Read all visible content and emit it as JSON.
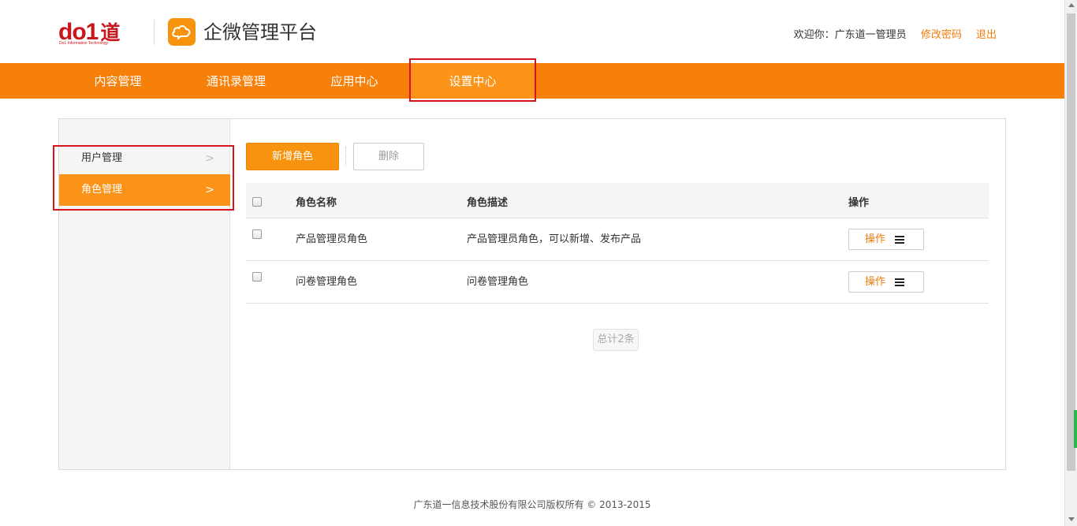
{
  "header": {
    "logo_text": "do1",
    "logo_dao": "道",
    "logo_subtitle": "Do1 Information Technology",
    "brand_icon": "cloud-chat-icon",
    "brand_title": "企微管理平台",
    "welcome": "欢迎你：广东道一管理员",
    "change_password": "修改密码",
    "logout": "退出"
  },
  "nav": {
    "items": [
      {
        "label": "内容管理"
      },
      {
        "label": "通讯录管理"
      },
      {
        "label": "应用中心"
      },
      {
        "label": "设置中心"
      }
    ],
    "active_index": 3
  },
  "sidebar": {
    "items": [
      {
        "label": "用户管理",
        "chevron": ">"
      },
      {
        "label": "角色管理",
        "chevron": ">"
      }
    ],
    "active_index": 1
  },
  "toolbar": {
    "add_label": "新增角色",
    "delete_label": "删除"
  },
  "table": {
    "columns": [
      "角色名称",
      "角色描述",
      "操作"
    ],
    "rows": [
      {
        "name": "产品管理员角色",
        "description": "产品管理员角色，可以新增、发布产品",
        "action": "操作"
      },
      {
        "name": "问卷管理角色",
        "description": "问卷管理角色",
        "action": "操作"
      }
    ],
    "total": "总计2条"
  },
  "footer": {
    "copyright": "广东道一信息技术股份有限公司版权所有 © 2013-2015"
  },
  "colors": {
    "accent": "#f7800a",
    "accent_light": "#fb9419",
    "link": "#f27c0b",
    "highlight_border": "#d8141c",
    "logo_red": "#c8161d"
  }
}
